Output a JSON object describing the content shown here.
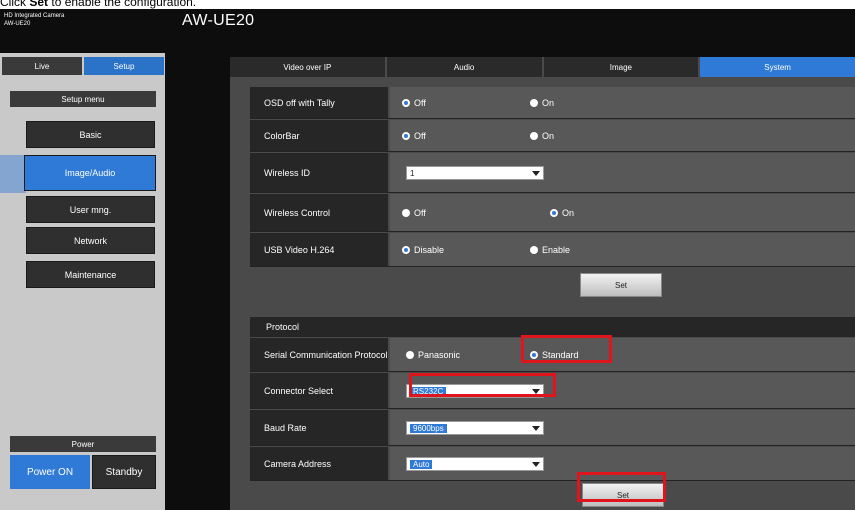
{
  "caption": {
    "prefix": "Click ",
    "bold": "Set",
    "suffix": " to enable the configuration."
  },
  "header": {
    "product_line1": "HD Integrated Camera",
    "product_line2": "AW-UE20",
    "model": "AW-UE20"
  },
  "mode_tabs": {
    "live": "Live",
    "setup": "Setup"
  },
  "setup_menu": {
    "title": "Setup menu",
    "items": [
      "Basic",
      "Image/Audio",
      "User mng.",
      "Network",
      "Maintenance"
    ],
    "active_index": 1
  },
  "power": {
    "title": "Power",
    "on": "Power ON",
    "standby": "Standby"
  },
  "tabs": {
    "items": [
      "Video over IP",
      "Audio",
      "Image",
      "System"
    ],
    "active_index": 3
  },
  "system_rows": [
    {
      "label": "OSD off with Tally",
      "type": "radio",
      "options": [
        "Off",
        "On"
      ],
      "selected": 0
    },
    {
      "label": "ColorBar",
      "type": "radio",
      "options": [
        "Off",
        "On"
      ],
      "selected": 0
    },
    {
      "label": "Wireless ID",
      "type": "select",
      "value": "1"
    },
    {
      "label": "Wireless Control",
      "type": "radio",
      "options": [
        "Off",
        "On"
      ],
      "selected": 1
    },
    {
      "label": "USB Video H.264",
      "type": "radio",
      "options": [
        "Disable",
        "Enable"
      ],
      "selected": 0
    }
  ],
  "set_label": "Set",
  "protocol": {
    "title": "Protocol",
    "rows": [
      {
        "label": "Serial Communication Protocol",
        "type": "radio",
        "options": [
          "Panasonic",
          "Standard"
        ],
        "selected": 1
      },
      {
        "label": "Connector Select",
        "type": "select",
        "value": "RS232C"
      },
      {
        "label": "Baud Rate",
        "type": "select",
        "value": "9600bps"
      },
      {
        "label": "Camera Address",
        "type": "select",
        "value": "Auto"
      }
    ]
  },
  "colors": {
    "accent": "#2f7ad6",
    "highlight": "#e0141c"
  }
}
